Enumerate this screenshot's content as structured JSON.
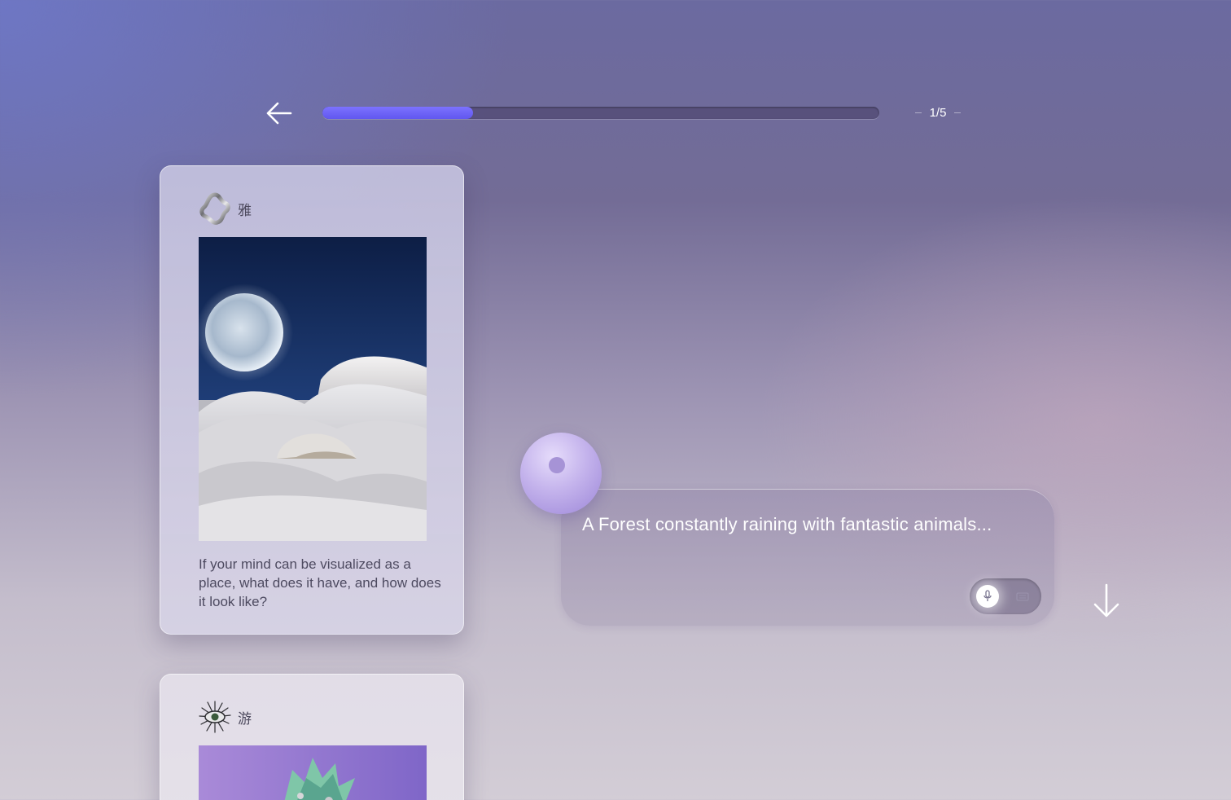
{
  "header": {
    "back_icon": "arrow-left-icon",
    "progress": {
      "current": 1,
      "total": 5,
      "fraction": 0.27
    },
    "counter_text": "1/5",
    "colors": {
      "progress_fill": "#6a60f5",
      "progress_track": "#4f4770"
    }
  },
  "cards": [
    {
      "logo_icon": "chrome-knot-logo-icon",
      "character": "雅",
      "image_subject": "moon-over-snow-dunes",
      "question": "If your mind can be visualized as a place, what does it have, and how does it look like?"
    },
    {
      "logo_icon": "spiky-eye-logo-icon",
      "character": "游",
      "image_subject": "green-crystal-creature"
    }
  ],
  "composer": {
    "avatar": "orb-avatar",
    "text": "A Forest constantly raining with fantastic animals...",
    "modes": {
      "active": "voice",
      "voice_icon": "microphone-icon",
      "text_icon": "keyboard-icon"
    },
    "submit_icon": "arrow-down-icon"
  },
  "colors": {
    "accent": "#6a60f5",
    "card_bg": "#cdcadf",
    "orb": "#b7a6e6"
  }
}
